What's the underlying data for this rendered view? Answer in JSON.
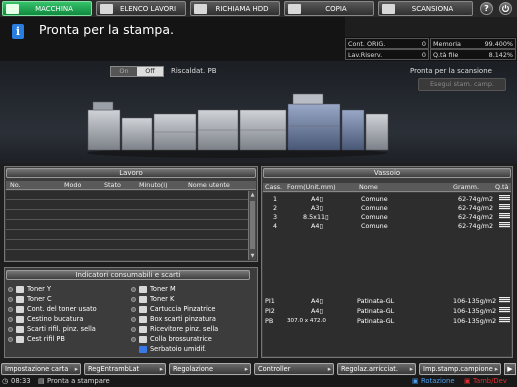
{
  "tabs": [
    {
      "label": "MACCHINA",
      "icon": "machine-icon"
    },
    {
      "label": "ELENCO LAVORI",
      "icon": "job-list-icon"
    },
    {
      "label": "RICHIAMA HDD",
      "icon": "hdd-icon"
    },
    {
      "label": "COPIA",
      "icon": "copy-icon"
    },
    {
      "label": "SCANSIONA",
      "icon": "scan-icon"
    }
  ],
  "help_button": "?",
  "status": {
    "message": "Pronta per la stampa.",
    "info_icon": "i"
  },
  "counters": {
    "orig_label": "Cont. ORIG.",
    "orig_value": "0",
    "memory_label": "Memoria",
    "memory_value": "99.400%",
    "reserved_label": "Lav.Riserv.",
    "reserved_value": "0",
    "hdd_label": "Q.tà file",
    "hdd_value": "8.142%"
  },
  "machine": {
    "toggle_on": "On",
    "toggle_off": "Off",
    "preheat_label": "Riscaldat. PB",
    "scan_ready": "Pronta per la scansione",
    "scan_button": "Esegui stam. camp."
  },
  "jobs": {
    "title": "Lavoro",
    "columns": [
      "No.",
      "Modo",
      "Stato",
      "Minuto(i)",
      "Nome utente"
    ]
  },
  "trays": {
    "title": "Vassoio",
    "columns": [
      "Cass.",
      "Form(Unit.mm)",
      "Nome",
      "Gramm.",
      "Q.tà"
    ],
    "rows": [
      {
        "tray": "1",
        "size": "A4▯",
        "name": "Comune",
        "weight": "62-74g/m2"
      },
      {
        "tray": "2",
        "size": "A3▯",
        "name": "Comune",
        "weight": "62-74g/m2"
      },
      {
        "tray": "3",
        "size": "8.5x11▯",
        "name": "Comune",
        "weight": "62-74g/m2"
      },
      {
        "tray": "4",
        "size": "A4▯",
        "name": "Comune",
        "weight": "62-74g/m2"
      }
    ],
    "rows_bottom": [
      {
        "tray": "PI1",
        "size": "A4▯",
        "name": "Patinata-GL",
        "weight": "106-135g/m2"
      },
      {
        "tray": "PI2",
        "size": "A4▯",
        "name": "Patinata-GL",
        "weight": "106-135g/m2"
      },
      {
        "tray": "PB",
        "size": "307.0 x 472.0",
        "name": "Patinata-GL",
        "weight": "106-135g/m2"
      }
    ]
  },
  "consumables": {
    "title": "Indicatori consumabili e scarti",
    "left": [
      {
        "label": "Toner Y",
        "icon": "toner-icon"
      },
      {
        "label": "Toner C",
        "icon": "toner-icon"
      },
      {
        "label": "Cont. del toner usato",
        "icon": "waste-toner-icon"
      },
      {
        "label": "Cestino bucatura",
        "icon": "punch-bin-icon"
      },
      {
        "label": "Scarti rifil. pinz. sella",
        "icon": "trim-scrap-icon"
      },
      {
        "label": "Cest rifil PB",
        "icon": "trim-bin-icon"
      }
    ],
    "right": [
      {
        "label": "Toner M",
        "icon": "toner-icon"
      },
      {
        "label": "Toner K",
        "icon": "toner-icon"
      },
      {
        "label": "Cartuccia Pinzatrice",
        "icon": "staple-cartridge-icon"
      },
      {
        "label": "Box scarti pinzatura",
        "icon": "staple-waste-icon"
      },
      {
        "label": "Ricevitore pinz. sella",
        "icon": "saddle-receiver-icon"
      },
      {
        "label": "Colla brossuratrice",
        "icon": "glue-icon"
      },
      {
        "label": "Serbatoio umidif.",
        "icon": "humidifier-tank-icon"
      }
    ]
  },
  "bottom_buttons": [
    {
      "label": "Impostazione carta"
    },
    {
      "label": "RegEntrambLat"
    },
    {
      "label": "Regolazione"
    },
    {
      "label": "Controller"
    },
    {
      "label": "Regolaz.arricciat."
    },
    {
      "label": "Imp.stamp.campione"
    }
  ],
  "play_button": "▶",
  "footer": {
    "time": "08:33",
    "status": "Pronta a stampare",
    "rotation": "Rotazione",
    "toner_dev": "Tamb/Dev"
  },
  "colors": {
    "active_tab": "#1fa652",
    "info_blue": "#2a7de0",
    "rotation_blue": "#4a9ff5",
    "toner_dev_red": "#e03030"
  }
}
